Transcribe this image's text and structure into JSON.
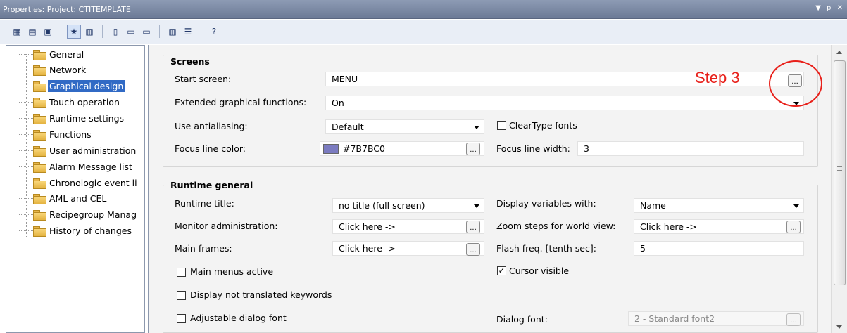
{
  "window": {
    "title": "Properties: Project: CTITEMPLATE",
    "controls": [
      "▼",
      "ᵽ",
      "✕"
    ]
  },
  "toolbar": {
    "buttons": [
      {
        "icon": "grid-icon",
        "glyph": "▦"
      },
      {
        "icon": "doc-list-icon",
        "glyph": "▤"
      },
      {
        "icon": "window-icon",
        "glyph": "▣"
      },
      {
        "icon": "star-icon",
        "glyph": "★"
      },
      {
        "icon": "properties-icon",
        "glyph": "▥"
      },
      {
        "icon": "page-icon",
        "glyph": "▯"
      },
      {
        "icon": "field-icon",
        "glyph": "▭"
      },
      {
        "icon": "field2-icon",
        "glyph": "▭"
      },
      {
        "icon": "columns-icon",
        "glyph": "▥"
      },
      {
        "icon": "list-icon",
        "glyph": "☰"
      },
      {
        "icon": "help-icon",
        "glyph": "?"
      }
    ]
  },
  "tree": {
    "items": [
      {
        "label": "General"
      },
      {
        "label": "Network"
      },
      {
        "label": "Graphical design"
      },
      {
        "label": "Touch operation"
      },
      {
        "label": "Runtime settings"
      },
      {
        "label": "Functions"
      },
      {
        "label": "User administration"
      },
      {
        "label": "Alarm Message list"
      },
      {
        "label": "Chronologic event li"
      },
      {
        "label": "AML and CEL"
      },
      {
        "label": "Recipegroup Manag"
      },
      {
        "label": "History of changes"
      }
    ],
    "selected_index": 2
  },
  "screens": {
    "title": "Screens",
    "start_screen_label": "Start screen:",
    "start_screen_value": "MENU",
    "ext_func_label": "Extended graphical functions:",
    "ext_func_value": "On",
    "antialias_label": "Use antialiasing:",
    "antialias_value": "Default",
    "cleartype_label": "ClearType fonts",
    "cleartype_checked": false,
    "focus_color_label": "Focus line color:",
    "focus_color_value": "#7B7BC0",
    "focus_color_swatch": "#7b7bc0",
    "focus_width_label": "Focus line width:",
    "focus_width_value": "3"
  },
  "runtime": {
    "title": "Runtime general",
    "runtime_title_label": "Runtime title:",
    "runtime_title_value": "no title (full screen)",
    "display_vars_label": "Display variables with:",
    "display_vars_value": "Name",
    "monitor_admin_label": "Monitor administration:",
    "monitor_admin_value": "Click here ->",
    "zoom_steps_label": "Zoom steps for world view:",
    "zoom_steps_value": "Click here ->",
    "main_frames_label": "Main frames:",
    "main_frames_value": "Click here ->",
    "flash_freq_label": "Flash freq. [tenth sec]:",
    "flash_freq_value": "5",
    "main_menus_label": "Main menus active",
    "main_menus_checked": false,
    "cursor_visible_label": "Cursor visible",
    "cursor_visible_checked": true,
    "display_not_translated_label": "Display not translated keywords",
    "display_not_translated_checked": false,
    "adjustable_font_label": "Adjustable dialog font",
    "adjustable_font_checked": false,
    "dialog_font_label": "Dialog font:",
    "dialog_font_value": "2 - Standard font2"
  },
  "annotation": {
    "step_label": "Step 3",
    "color": "#e8201a"
  },
  "common": {
    "ellipsis": "..."
  }
}
